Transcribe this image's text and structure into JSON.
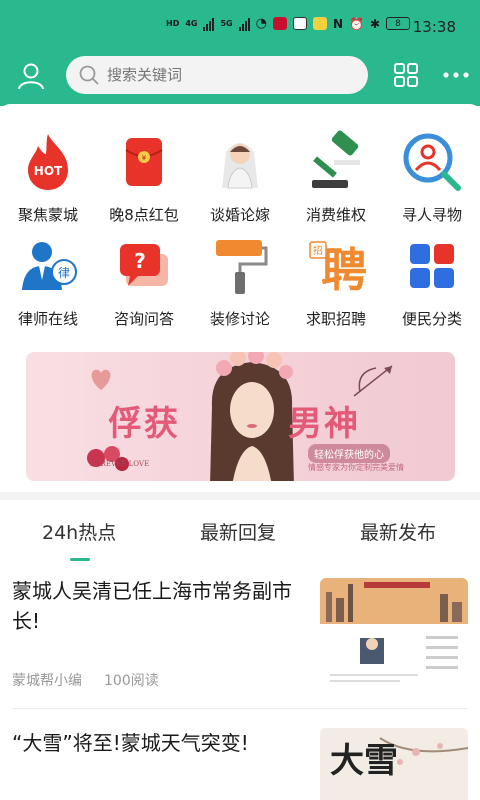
{
  "status_bar": {
    "time": "13:38",
    "battery": "8",
    "network_4g": "4G",
    "network_5g": "5G",
    "hd": "HD"
  },
  "header": {
    "search_placeholder": "搜索关键词"
  },
  "categories": [
    {
      "label": "聚焦蒙城",
      "icon": "hot-flame-icon",
      "badge": "HOT"
    },
    {
      "label": "晚8点红包",
      "icon": "red-envelope-icon"
    },
    {
      "label": "谈婚论嫁",
      "icon": "bride-icon"
    },
    {
      "label": "消费维权",
      "icon": "gavel-icon"
    },
    {
      "label": "寻人寻物",
      "icon": "person-search-icon"
    },
    {
      "label": "律师在线",
      "icon": "lawyer-icon",
      "badge": "律"
    },
    {
      "label": "咨询问答",
      "icon": "question-bubble-icon",
      "badge": "?"
    },
    {
      "label": "装修讨论",
      "icon": "paint-roller-icon"
    },
    {
      "label": "求职招聘",
      "icon": "recruit-icon",
      "badge": "聘",
      "badge_small": "招"
    },
    {
      "label": "便民分类",
      "icon": "category-tiles-icon"
    }
  ],
  "banner": {
    "title_left": "俘获",
    "title_right": "男神",
    "subtitle": "轻松俘获他的心",
    "caption": "情感专家为你定制完美爱情",
    "watermark": "FOREVER LOVE"
  },
  "tabs": [
    {
      "label": "24h热点",
      "active": true
    },
    {
      "label": "最新回复",
      "active": false
    },
    {
      "label": "最新发布",
      "active": false
    }
  ],
  "news": [
    {
      "title": "蒙城人吴清已任上海市常务副市长!",
      "author": "蒙城帮小编",
      "reads": "100阅读"
    },
    {
      "title": "“大雪”将至!蒙城天气突变!",
      "thumb_text": "大雪"
    }
  ],
  "colors": {
    "accent": "#2ab88f",
    "hot_red": "#e8332a",
    "banner_pink": "#e35a78"
  }
}
